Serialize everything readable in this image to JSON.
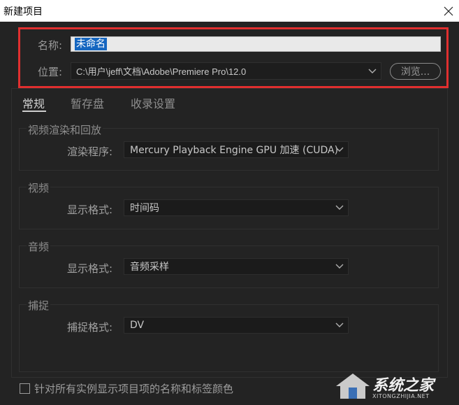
{
  "window": {
    "title": "新建项目"
  },
  "name_field": {
    "label": "名称:",
    "value": "未命名"
  },
  "location": {
    "label": "位置:",
    "value": "C:\\用户\\jeff\\文档\\Adobe\\Premiere Pro\\12.0",
    "browse_label": "浏览..."
  },
  "tabs": [
    {
      "label": "常规",
      "active": true
    },
    {
      "label": "暂存盘",
      "active": false
    },
    {
      "label": "收录设置",
      "active": false
    }
  ],
  "groups": {
    "render": {
      "title": "视频渲染和回放",
      "row_label": "渲染程序:",
      "value": "Mercury Playback Engine GPU 加速 (CUDA)"
    },
    "video": {
      "title": "视频",
      "row_label": "显示格式:",
      "value": "时间码"
    },
    "audio": {
      "title": "音频",
      "row_label": "显示格式:",
      "value": "音频采样"
    },
    "capture": {
      "title": "捕捉",
      "row_label": "捕捉格式:",
      "value": "DV"
    }
  },
  "checkbox": {
    "label": "针对所有实例显示项目项的名称和标签颜色",
    "checked": false
  },
  "watermark": {
    "brand": "系统之家",
    "url": "XITONGZHIJIA.NET"
  },
  "colors": {
    "highlight": "#e02f2f",
    "selection": "#1566c0",
    "background": "#232323"
  }
}
